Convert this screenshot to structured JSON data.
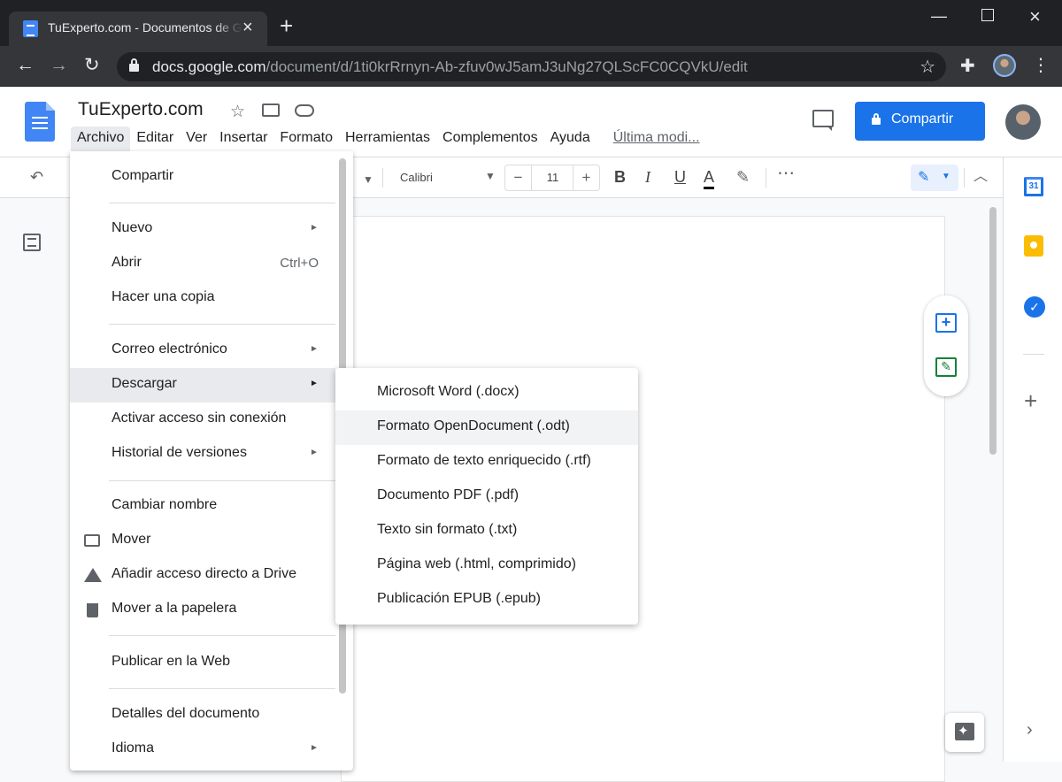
{
  "browser": {
    "tab_title": "TuExperto.com - Documentos de Google",
    "url_host": "docs.google.com",
    "url_path": "/document/d/1ti0krRrnyn-Ab-zfuv0wJ5amJ3uNg27QLScFC0CQVkU/edit"
  },
  "doc": {
    "title": "TuExperto.com",
    "share_label": "Compartir",
    "menus": [
      "Archivo",
      "Editar",
      "Ver",
      "Insertar",
      "Formato",
      "Herramientas",
      "Complementos",
      "Ayuda"
    ],
    "last_edit": "Última modi..."
  },
  "toolbar": {
    "font": "Calibri",
    "font_size": "11",
    "minus": "−",
    "plus": "+"
  },
  "file_menu": {
    "items": [
      {
        "label": "Compartir"
      },
      {
        "label": "Nuevo",
        "submenu": true
      },
      {
        "label": "Abrir",
        "shortcut": "Ctrl+O"
      },
      {
        "label": "Hacer una copia"
      },
      {
        "label": "Correo electrónico",
        "submenu": true
      },
      {
        "label": "Descargar",
        "submenu": true,
        "highlighted": true
      },
      {
        "label": "Activar acceso sin conexión"
      },
      {
        "label": "Historial de versiones",
        "submenu": true
      },
      {
        "label": "Cambiar nombre"
      },
      {
        "label": "Mover",
        "icon": "folder-move-icon"
      },
      {
        "label": "Añadir acceso directo a Drive",
        "icon": "drive-icon"
      },
      {
        "label": "Mover a la papelera",
        "icon": "trash-icon"
      },
      {
        "label": "Publicar en la Web"
      },
      {
        "label": "Detalles del documento"
      },
      {
        "label": "Idioma",
        "submenu": true
      }
    ]
  },
  "download_submenu": {
    "items": [
      {
        "label": "Microsoft Word (.docx)"
      },
      {
        "label": "Formato OpenDocument (.odt)",
        "highlighted": true
      },
      {
        "label": "Formato de texto enriquecido (.rtf)"
      },
      {
        "label": "Documento PDF (.pdf)"
      },
      {
        "label": "Texto sin formato (.txt)"
      },
      {
        "label": "Página web (.html, comprimido)"
      },
      {
        "label": "Publicación EPUB (.epub)"
      }
    ]
  },
  "side_panel": {
    "calendar_day": "31"
  }
}
